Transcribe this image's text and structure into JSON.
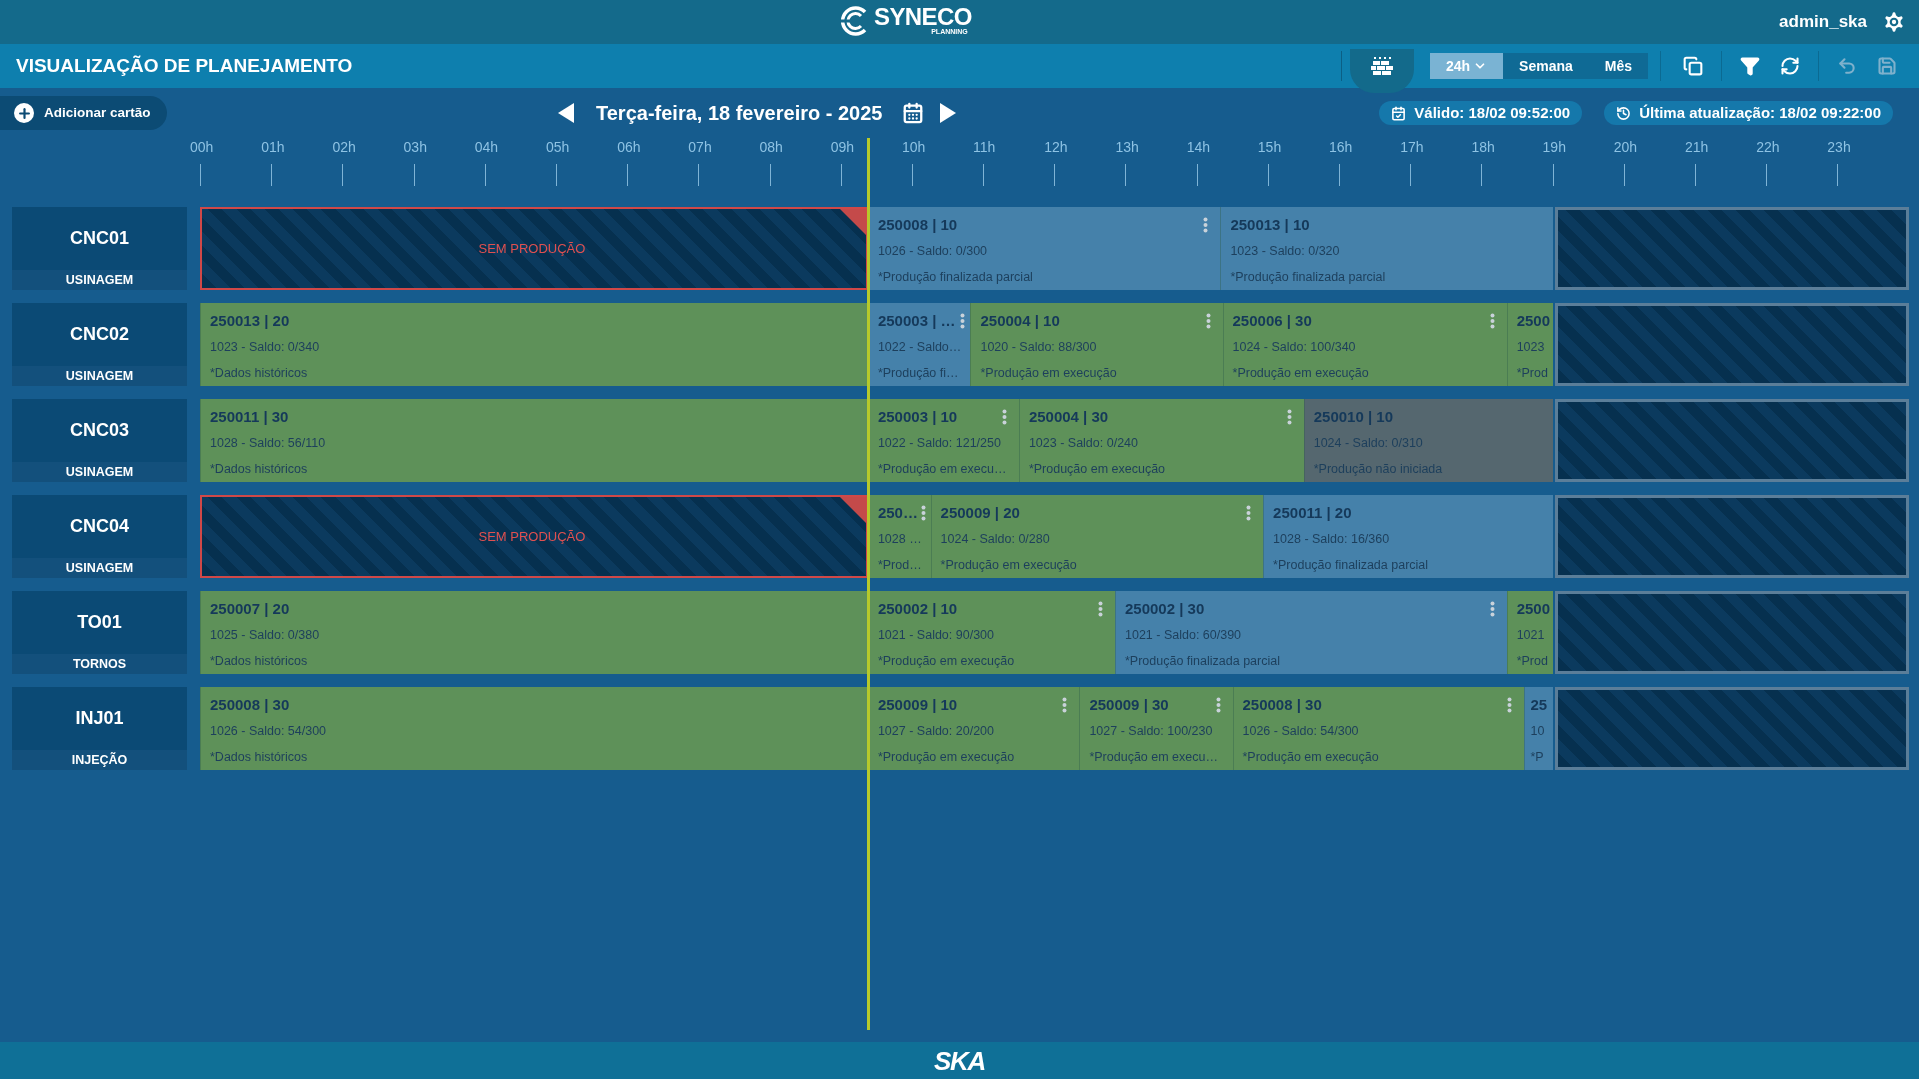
{
  "header": {
    "logo_text": "SYNECO",
    "logo_subtext": "PLANNING",
    "user": "admin_ska"
  },
  "title": "VISUALIZAÇÃO DE PLANEJAMENTO",
  "view_options": [
    {
      "label": "24h",
      "selected": true
    },
    {
      "label": "Semana",
      "selected": false
    },
    {
      "label": "Mês",
      "selected": false
    }
  ],
  "toolbar": [
    {
      "kind": "copy",
      "disabled": false
    },
    {
      "kind": "filter",
      "disabled": false
    },
    {
      "kind": "refresh",
      "disabled": false
    },
    {
      "kind": "undo",
      "disabled": true
    },
    {
      "kind": "save",
      "disabled": true
    }
  ],
  "add_card_button": "Adicionar cartão",
  "date": "Terça-feira, 18 fevereiro - 2025",
  "valid_badge": "Válido: 18/02 09:52:00",
  "updated_badge": "Última atualização: 18/02 09:22:00",
  "hours": [
    "00h",
    "01h",
    "02h",
    "03h",
    "04h",
    "05h",
    "06h",
    "07h",
    "08h",
    "09h",
    "10h",
    "11h",
    "12h",
    "13h",
    "14h",
    "15h",
    "16h",
    "17h",
    "18h",
    "19h",
    "20h",
    "21h",
    "22h",
    "23h"
  ],
  "machines": [
    {
      "name": "CNC01",
      "group": "USINAGEM",
      "blocks": [
        {
          "kind": "idle",
          "label": "SEM PRODUÇÃO"
        },
        {
          "kind": "partial",
          "title": "250008 | 10",
          "detail": "1026 - Saldo: 0/300",
          "note": "*Produção finalizada parcial",
          "menu": true
        },
        {
          "kind": "partial",
          "title": "250013 | 10",
          "detail": "1023 - Saldo: 0/320",
          "note": "*Produção finalizada parcial",
          "menu": false
        }
      ]
    },
    {
      "name": "CNC02",
      "group": "USINAGEM",
      "blocks": [
        {
          "kind": "historical",
          "title": "250013 | 20",
          "detail": "1023 - Saldo: 0/340",
          "note": "*Dados históricos",
          "menu": false
        },
        {
          "kind": "partial",
          "title": "250003 | …",
          "detail": "1022 - Saldo…",
          "note": "*Produção fi…",
          "menu": true
        },
        {
          "kind": "running",
          "title": "250004 | 10",
          "detail": "1020 - Saldo: 88/300",
          "note": "*Produção em execução",
          "menu": true
        },
        {
          "kind": "running",
          "title": "250006 | 30",
          "detail": "1024 - Saldo: 100/340",
          "note": "*Produção em execução",
          "menu": true
        },
        {
          "kind": "running",
          "title": "2500",
          "detail": "1023",
          "note": "*Prod",
          "menu": false
        }
      ]
    },
    {
      "name": "CNC03",
      "group": "USINAGEM",
      "blocks": [
        {
          "kind": "historical",
          "title": "250011 | 30",
          "detail": "1028 - Saldo: 56/110",
          "note": "*Dados históricos",
          "menu": false
        },
        {
          "kind": "running",
          "title": "250003 | 10",
          "detail": "1022 - Saldo: 121/250",
          "note": "*Produção em execu…",
          "menu": true
        },
        {
          "kind": "running",
          "title": "250004 | 30",
          "detail": "1023 - Saldo: 0/240",
          "note": "*Produção em execução",
          "menu": true
        },
        {
          "kind": "not_started",
          "title": "250010 | 10",
          "detail": "1024 - Saldo: 0/310",
          "note": "*Produção não iniciada",
          "menu": false
        }
      ]
    },
    {
      "name": "CNC04",
      "group": "USINAGEM",
      "blocks": [
        {
          "kind": "idle",
          "label": "SEM PRODUÇÃO"
        },
        {
          "kind": "running",
          "title": "250…",
          "detail": "1028 …",
          "note": "*Prod…",
          "menu": true
        },
        {
          "kind": "running",
          "title": "250009 | 20",
          "detail": "1024 - Saldo: 0/280",
          "note": "*Produção em execução",
          "menu": true
        },
        {
          "kind": "partial",
          "title": "250011 | 20",
          "detail": "1028 - Saldo: 16/360",
          "note": "*Produção finalizada parcial",
          "menu": false
        }
      ]
    },
    {
      "name": "TO01",
      "group": "TORNOS",
      "blocks": [
        {
          "kind": "historical",
          "title": "250007 | 20",
          "detail": "1025 - Saldo: 0/380",
          "note": "*Dados históricos",
          "menu": false
        },
        {
          "kind": "running",
          "title": "250002 | 10",
          "detail": "1021 - Saldo: 90/300",
          "note": "*Produção em execução",
          "menu": true
        },
        {
          "kind": "partial",
          "title": "250002 | 30",
          "detail": "1021 - Saldo: 60/390",
          "note": "*Produção finalizada parcial",
          "menu": true
        },
        {
          "kind": "running",
          "title": "2500",
          "detail": "1021",
          "note": "*Prod",
          "menu": false
        }
      ]
    },
    {
      "name": "INJ01",
      "group": "INJEÇÃO",
      "blocks": [
        {
          "kind": "historical",
          "title": "250008 | 30",
          "detail": "1026 - Saldo: 54/300",
          "note": "*Dados históricos",
          "menu": false
        },
        {
          "kind": "running",
          "title": "250009 | 10",
          "detail": "1027 - Saldo: 20/200",
          "note": "*Produção em execução",
          "menu": true
        },
        {
          "kind": "running",
          "title": "250009 | 30",
          "detail": "1027 - Saldo: 100/230",
          "note": "*Produção em execu…",
          "menu": true
        },
        {
          "kind": "running",
          "title": "250008 | 30",
          "detail": "1026 - Saldo: 54/300",
          "note": "*Produção em execução",
          "menu": true
        },
        {
          "kind": "partial",
          "title": "25",
          "detail": "10",
          "note": "*P",
          "menu": false
        }
      ]
    }
  ],
  "footer_logo": "SKA"
}
